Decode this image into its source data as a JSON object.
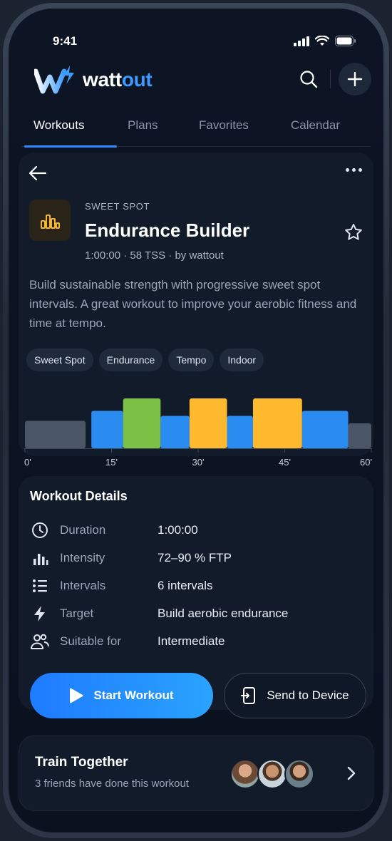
{
  "status": {
    "time": "9:41"
  },
  "app": {
    "name_prefix": "watt",
    "name_suffix": "out"
  },
  "tabs": [
    {
      "label": "Workouts",
      "active": true
    },
    {
      "label": "Plans"
    },
    {
      "label": "Favorites"
    },
    {
      "label": "Calendar"
    }
  ],
  "workout": {
    "category": "SWEET SPOT",
    "title": "Endurance Builder",
    "meta": "1:00:00 · 58 TSS · by wattout",
    "description": "Build sustainable strength with progressive sweet spot intervals. A great workout to improve your aerobic fitness and time at tempo.",
    "tags": [
      "Sweet Spot",
      "Endurance",
      "Tempo",
      "Indoor"
    ]
  },
  "chart_data": {
    "type": "bar",
    "tick_labels": [
      "0'",
      "15'",
      "30'",
      "45'",
      "60'"
    ],
    "x_range_min": [
      0,
      60
    ],
    "blocks": [
      {
        "start": 0,
        "end": 10.5,
        "level": 0.55,
        "zone": "gray"
      },
      {
        "start": 11.5,
        "end": 17,
        "level": 0.75,
        "zone": "blue"
      },
      {
        "start": 17,
        "end": 23.5,
        "level": 1.0,
        "zone": "green"
      },
      {
        "start": 23.5,
        "end": 28.5,
        "level": 0.65,
        "zone": "blue"
      },
      {
        "start": 28.5,
        "end": 35,
        "level": 1.0,
        "zone": "yellow"
      },
      {
        "start": 35,
        "end": 39.5,
        "level": 0.65,
        "zone": "blue"
      },
      {
        "start": 39.5,
        "end": 48,
        "level": 1.0,
        "zone": "yellow"
      },
      {
        "start": 48,
        "end": 56,
        "level": 0.75,
        "zone": "blue"
      },
      {
        "start": 56,
        "end": 60,
        "level": 0.5,
        "zone": "gray"
      }
    ],
    "colors": {
      "gray": "#4a5566",
      "blue": "#2a8cf0",
      "green": "#7cc045",
      "yellow": "#ffb92e"
    }
  },
  "details": {
    "title": "Workout Details",
    "rows": [
      {
        "icon": "clock-icon",
        "label": "Duration",
        "value": "1:00:00"
      },
      {
        "icon": "bar-chart-icon",
        "label": "Intensity",
        "value": "72–90 % FTP"
      },
      {
        "icon": "list-icon",
        "label": "Intervals",
        "value": "6 intervals"
      },
      {
        "icon": "bolt-icon",
        "label": "Target",
        "value": "Build aerobic endurance"
      },
      {
        "icon": "users-icon",
        "label": "Suitable for",
        "value": "Intermediate"
      }
    ],
    "start_label": "Start Workout",
    "send_label": "Send to Device"
  },
  "train": {
    "title": "Train Together",
    "subtitle": "3 friends have done this workout"
  }
}
